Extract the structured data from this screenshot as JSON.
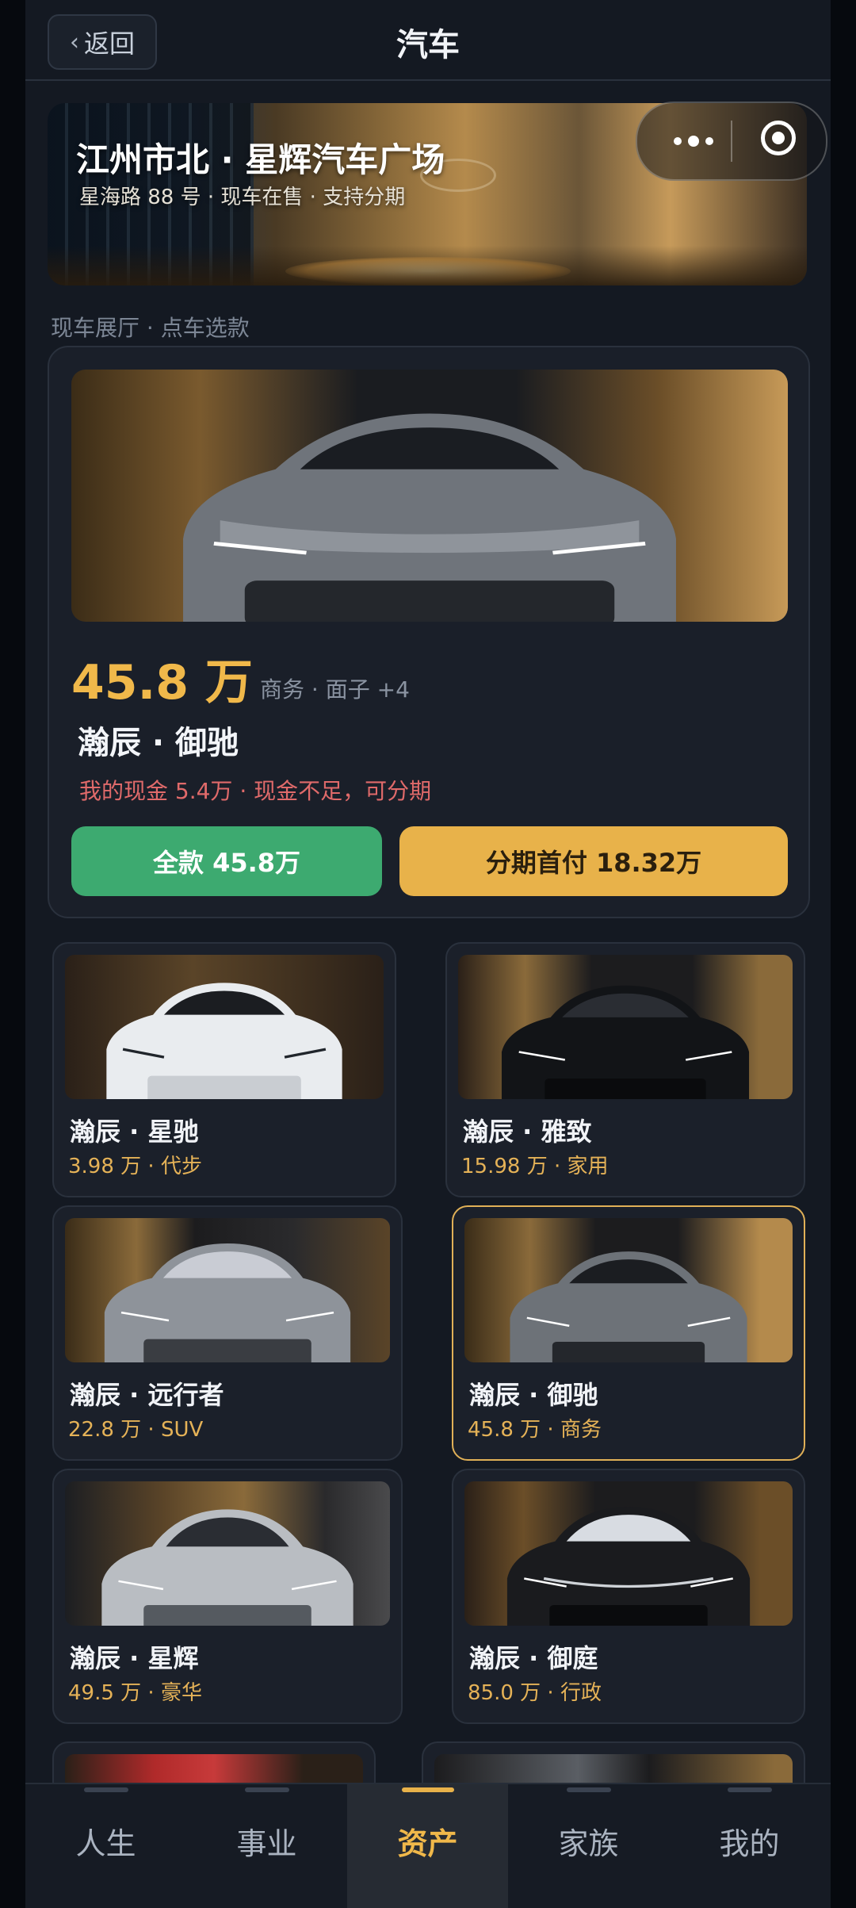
{
  "header": {
    "back_label": "返回",
    "title": "汽车"
  },
  "hero": {
    "title": "江州市北 · 星辉汽车广场",
    "subtitle": "星海路 88 号 · 现车在售 · 支持分期"
  },
  "section_label": "现车展厅 · 点车选款",
  "featured": {
    "price": "45.8 万",
    "tags": "商务 · 面子 +4",
    "name": "瀚辰 · 御驰",
    "cash_note": "我的现金 5.4万 · 现金不足，可分期",
    "full_pay_label": "全款 45.8万",
    "installment_label": "分期首付 18.32万"
  },
  "cars": [
    {
      "name": "瀚辰 · 星驰",
      "meta": "3.98 万 · 代步",
      "color": "#e9ecef"
    },
    {
      "name": "瀚辰 · 雅致",
      "meta": "15.98 万 · 家用",
      "color": "#121417"
    },
    {
      "name": "瀚辰 · 远行者",
      "meta": "22.8 万 · SUV",
      "color": "#8e939a"
    },
    {
      "name": "瀚辰 · 御驰",
      "meta": "45.8 万 · 商务",
      "color": "#6d7278",
      "selected": true
    },
    {
      "name": "瀚辰 · 星辉",
      "meta": "49.5 万 · 豪华",
      "color": "#b9bdc2"
    },
    {
      "name": "瀚辰 · 御庭",
      "meta": "85.0 万 · 行政",
      "color": "#1a1b1e"
    }
  ],
  "tabs": [
    {
      "label": "人生"
    },
    {
      "label": "事业"
    },
    {
      "label": "资产",
      "active": true
    },
    {
      "label": "家族"
    },
    {
      "label": "我的"
    }
  ],
  "colors": {
    "accent": "#e8b24a",
    "green": "#3daa70",
    "warning": "#e06a6a"
  },
  "icons": [
    "chevron-left-icon",
    "more-dots-icon",
    "target-icon"
  ]
}
